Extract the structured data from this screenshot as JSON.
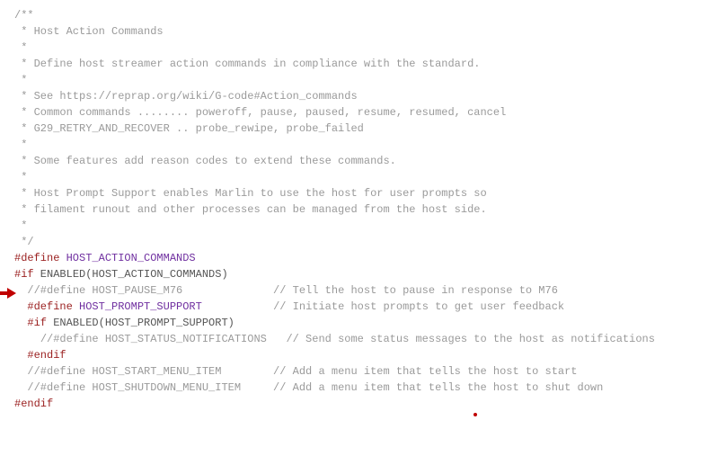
{
  "lines": [
    [
      [
        "comment",
        "/**"
      ]
    ],
    [
      [
        "comment",
        " * Host Action Commands"
      ]
    ],
    [
      [
        "comment",
        " *"
      ]
    ],
    [
      [
        "comment",
        " * Define host streamer action commands in compliance with the standard."
      ]
    ],
    [
      [
        "comment",
        " *"
      ]
    ],
    [
      [
        "comment",
        " * See https://reprap.org/wiki/G-code#Action_commands"
      ]
    ],
    [
      [
        "comment",
        " * Common commands ........ poweroff, pause, paused, resume, resumed, cancel"
      ]
    ],
    [
      [
        "comment",
        " * G29_RETRY_AND_RECOVER .. probe_rewipe, probe_failed"
      ]
    ],
    [
      [
        "comment",
        " *"
      ]
    ],
    [
      [
        "comment",
        " * Some features add reason codes to extend these commands."
      ]
    ],
    [
      [
        "comment",
        " *"
      ]
    ],
    [
      [
        "comment",
        " * Host Prompt Support enables Marlin to use the host for user prompts so"
      ]
    ],
    [
      [
        "comment",
        " * filament runout and other processes can be managed from the host side."
      ]
    ],
    [
      [
        "comment",
        " *"
      ]
    ],
    [
      [
        "comment",
        " */"
      ]
    ],
    [
      [
        "directive",
        "#define "
      ],
      [
        "defined",
        "HOST_ACTION_COMMANDS"
      ]
    ],
    [
      [
        "directive",
        "#if"
      ],
      [
        "plain",
        " ENABLED(HOST_ACTION_COMMANDS)"
      ]
    ],
    [
      [
        "plain",
        "  "
      ],
      [
        "comment",
        "//#define HOST_PAUSE_M76              // Tell the host to pause in response to M76"
      ]
    ],
    [
      [
        "plain",
        "  "
      ],
      [
        "directive",
        "#define "
      ],
      [
        "defined",
        "HOST_PROMPT_SUPPORT"
      ],
      [
        "plain",
        "           "
      ],
      [
        "comment",
        "// Initiate host prompts to get user feedback"
      ]
    ],
    [
      [
        "plain",
        "  "
      ],
      [
        "directive",
        "#if"
      ],
      [
        "plain",
        " ENABLED(HOST_PROMPT_SUPPORT)"
      ]
    ],
    [
      [
        "plain",
        "    "
      ],
      [
        "comment",
        "//#define HOST_STATUS_NOTIFICATIONS   // Send some status messages to the host as notifications"
      ]
    ],
    [
      [
        "plain",
        "  "
      ],
      [
        "directive",
        "#endif"
      ]
    ],
    [
      [
        "plain",
        "  "
      ],
      [
        "comment",
        "//#define HOST_START_MENU_ITEM        // Add a menu item that tells the host to start"
      ]
    ],
    [
      [
        "plain",
        "  "
      ],
      [
        "comment",
        "//#define HOST_SHUTDOWN_MENU_ITEM     // Add a menu item that tells the host to shut down"
      ]
    ],
    [
      [
        "directive",
        "#endif"
      ]
    ]
  ],
  "arrow_color": "#c00000"
}
